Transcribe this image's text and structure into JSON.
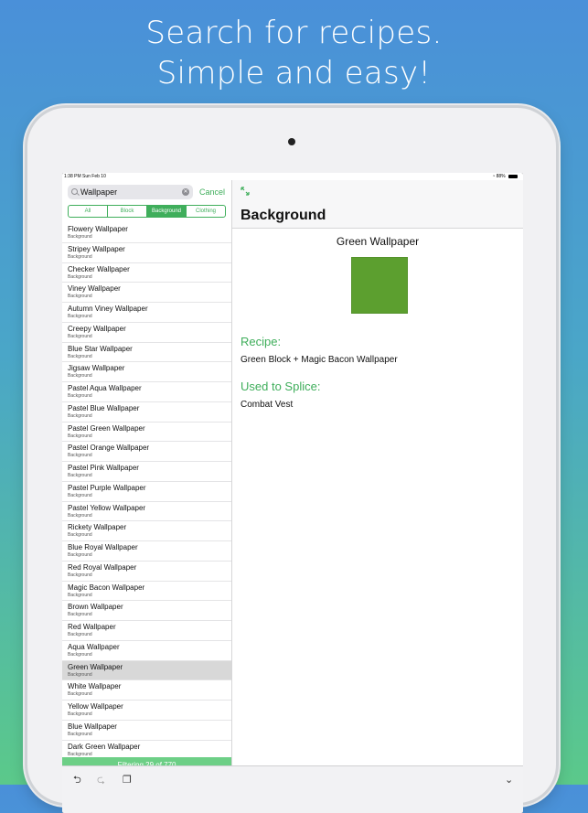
{
  "headline": {
    "line1": "Search for recipes.",
    "line2": "Simple and easy!"
  },
  "status_bar": {
    "time_date": "1:38 PM  Sun Feb 10",
    "battery": "88%"
  },
  "search": {
    "value": "Wallpaper",
    "cancel_label": "Cancel"
  },
  "segments": [
    "All",
    "Block",
    "Background",
    "Clothing"
  ],
  "active_segment": "Background",
  "items": [
    {
      "title": "Flowery Wallpaper",
      "subtitle": "Background"
    },
    {
      "title": "Stripey Wallpaper",
      "subtitle": "Background"
    },
    {
      "title": "Checker Wallpaper",
      "subtitle": "Background"
    },
    {
      "title": "Viney Wallpaper",
      "subtitle": "Background"
    },
    {
      "title": "Autumn Viney Wallpaper",
      "subtitle": "Background"
    },
    {
      "title": "Creepy Wallpaper",
      "subtitle": "Background"
    },
    {
      "title": "Blue Star Wallpaper",
      "subtitle": "Background"
    },
    {
      "title": "Jigsaw Wallpaper",
      "subtitle": "Background"
    },
    {
      "title": "Pastel Aqua Wallpaper",
      "subtitle": "Background"
    },
    {
      "title": "Pastel Blue Wallpaper",
      "subtitle": "Background"
    },
    {
      "title": "Pastel Green Wallpaper",
      "subtitle": "Background"
    },
    {
      "title": "Pastel Orange Wallpaper",
      "subtitle": "Background"
    },
    {
      "title": "Pastel Pink Wallpaper",
      "subtitle": "Background"
    },
    {
      "title": "Pastel Purple Wallpaper",
      "subtitle": "Background"
    },
    {
      "title": "Pastel Yellow Wallpaper",
      "subtitle": "Background"
    },
    {
      "title": "Rickety Wallpaper",
      "subtitle": "Background"
    },
    {
      "title": "Blue Royal Wallpaper",
      "subtitle": "Background"
    },
    {
      "title": "Red Royal Wallpaper",
      "subtitle": "Background"
    },
    {
      "title": "Magic Bacon Wallpaper",
      "subtitle": "Background"
    },
    {
      "title": "Brown Wallpaper",
      "subtitle": "Background"
    },
    {
      "title": "Red Wallpaper",
      "subtitle": "Background"
    },
    {
      "title": "Aqua Wallpaper",
      "subtitle": "Background"
    },
    {
      "title": "Green Wallpaper",
      "subtitle": "Background",
      "selected": true
    },
    {
      "title": "White Wallpaper",
      "subtitle": "Background"
    },
    {
      "title": "Yellow Wallpaper",
      "subtitle": "Background"
    },
    {
      "title": "Blue Wallpaper",
      "subtitle": "Background"
    },
    {
      "title": "Dark Green Wallpaper",
      "subtitle": "Background"
    }
  ],
  "footer": "Filtering 29 of 770",
  "detail": {
    "title": "Background",
    "item_name": "Green Wallpaper",
    "swatch_color": "#5c9f2f",
    "recipe_heading": "Recipe:",
    "recipe_text": "Green Block + Magic Bacon Wallpaper",
    "used_heading": "Used to Splice:",
    "used_text": "Combat Vest"
  },
  "colors": {
    "accent": "#3fae5b",
    "footer_bg": "#6dcf86",
    "selected_row": "#d8d8d8"
  },
  "toolbar_icons": [
    "undo-icon",
    "redo-icon",
    "clipboard-icon",
    "chevron-down-icon"
  ]
}
